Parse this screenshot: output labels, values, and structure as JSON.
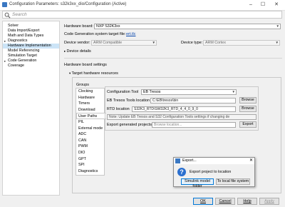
{
  "window": {
    "title": "Configuration Parameters: s32k3xx_dio/Configuration (Active)",
    "minimize": "–",
    "maximize": "☐",
    "close": "✕"
  },
  "search": {
    "placeholder": "Search"
  },
  "tree": {
    "items": [
      {
        "label": "Solver",
        "arrow": ""
      },
      {
        "label": "Data Import/Export",
        "arrow": ""
      },
      {
        "label": "Math and Data Types",
        "arrow": ""
      },
      {
        "label": "Diagnostics",
        "arrow": "▸"
      },
      {
        "label": "Hardware Implementation",
        "arrow": "",
        "selected": true
      },
      {
        "label": "Model Referencing",
        "arrow": ""
      },
      {
        "label": "Simulation Target",
        "arrow": ""
      },
      {
        "label": "Code Generation",
        "arrow": "▸"
      },
      {
        "label": "Coverage",
        "arrow": ""
      }
    ]
  },
  "hardware": {
    "board_label": "Hardware board:",
    "board_value": "NXP S32K3xx",
    "target_file_label": "Code Generation system target file:",
    "target_file_link": "ert.tlc",
    "vendor_label": "Device vendor:",
    "vendor_value": "ARM Compatible",
    "type_label": "Device type:",
    "type_value": "ARM Cortex",
    "device_details": "Device details",
    "board_settings": "Hardware board settings",
    "target_resources": "Target hardware resources"
  },
  "groups": {
    "title": "Groups",
    "items": [
      "Clocking",
      "Hardware",
      "Timers",
      "Download",
      "User Paths",
      "PIL",
      "External mode",
      "ADC",
      "CAN",
      "PWM",
      "DIO",
      "GPT",
      "SPI",
      "Diagnostics"
    ],
    "selected": "User Paths"
  },
  "user_paths": {
    "config_tool_label": "Configuration Tool",
    "config_tool_value": "EB Tresos",
    "eb_location_label": "EB Tresos Tools location",
    "eb_location_value": "C:\\EB\\tresos\\bin",
    "rtd_location_label": "RTD location",
    "rtd_location_value": "S32K3_RTD\\SW32K3_RTD_4_4_0_9_0",
    "browse_label": "Browse",
    "note": "Note: Update EB Tresos and S32 Configuration Tools settings if changing de",
    "export_label": "Export generated projects",
    "export_placeholder": "Browse location...",
    "export_button": "Export"
  },
  "dialog": {
    "title": "Export...",
    "close": "✕",
    "icon": "?",
    "message": "Export project to location",
    "btn_model": "Simulink model folder",
    "btn_fs": "To local file system"
  },
  "footer": {
    "ok": "OK",
    "cancel": "Cancel",
    "help": "Help",
    "apply": "Apply"
  }
}
